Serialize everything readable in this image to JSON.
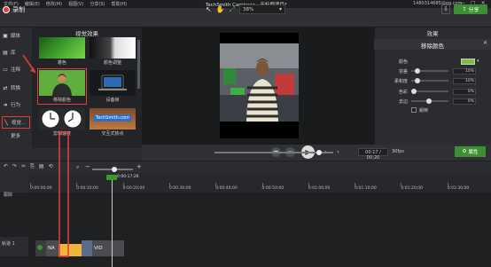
{
  "menu": [
    "文件(F)",
    "编辑(E)",
    "修改(M)",
    "视图(V)",
    "分享(S)",
    "帮助(H)"
  ],
  "window_title": "TechSmith Camtasia - 无标题项目*",
  "account": "1480314685@qq.com",
  "window_controls": [
    "—",
    "□",
    "✕"
  ],
  "toolbar": {
    "record_label": "录制",
    "zoom_value": "38%",
    "share_label": "分享",
    "tools": [
      "↖",
      "✋",
      "⤢"
    ]
  },
  "sidebar": {
    "items": [
      {
        "icon": "▣",
        "label": "媒体"
      },
      {
        "icon": "▤",
        "label": "库"
      },
      {
        "icon": "▭",
        "label": "注释"
      },
      {
        "icon": "⇄",
        "label": "转换"
      },
      {
        "icon": "➜",
        "label": "行为"
      },
      {
        "icon": "╲",
        "label": "视觉..."
      }
    ],
    "more": "更多"
  },
  "media_panel": {
    "title": "视觉效果",
    "tiles": [
      {
        "label": "着色"
      },
      {
        "label": "颜色调整"
      },
      {
        "label": "移除颜色"
      },
      {
        "label": "设备帧"
      },
      {
        "label": "剪辑速度"
      },
      {
        "label": "交互式热点"
      }
    ],
    "techsmith_label": "TechSmith.com"
  },
  "properties": {
    "header": "效果",
    "effect": "移除颜色",
    "rows": [
      {
        "label": "颜色",
        "value": ""
      },
      {
        "label": "容差",
        "value": "10%",
        "level": 0.12
      },
      {
        "label": "柔和度",
        "value": "10%",
        "level": 0.12
      },
      {
        "label": "色彩",
        "value": "0%",
        "level": 0.0
      },
      {
        "label": "去边",
        "value": "0%",
        "level": 0.48
      }
    ],
    "invert_label": "颠倒",
    "props_button": "属性",
    "accent_color": "#7fbf3f"
  },
  "playback": {
    "time": "00:17 / 00:20",
    "fps": "30fps",
    "progress": 0.88
  },
  "timeline": {
    "playhead_time": "0:00:17;26",
    "ticks": [
      "0:00:00;00",
      "0:00:10;00",
      "0:00:20;00",
      "0:00:30;00",
      "0:00:40;00",
      "0:00:50;00",
      "0:01:00;00",
      "0:01:10;00",
      "0:01:20;00",
      "0:01:30;00",
      "0:01:40;00",
      "0:01:50;00",
      "0:02:00;00"
    ],
    "track_label": "轨道 1",
    "clip_na": "NA",
    "clip_vid": "VID",
    "tools": [
      "↶",
      "↷",
      "✂",
      "⎘",
      "▤",
      "⟲"
    ],
    "zoom_minus": "−",
    "zoom_plus": "+",
    "side_label": "跟踪"
  }
}
